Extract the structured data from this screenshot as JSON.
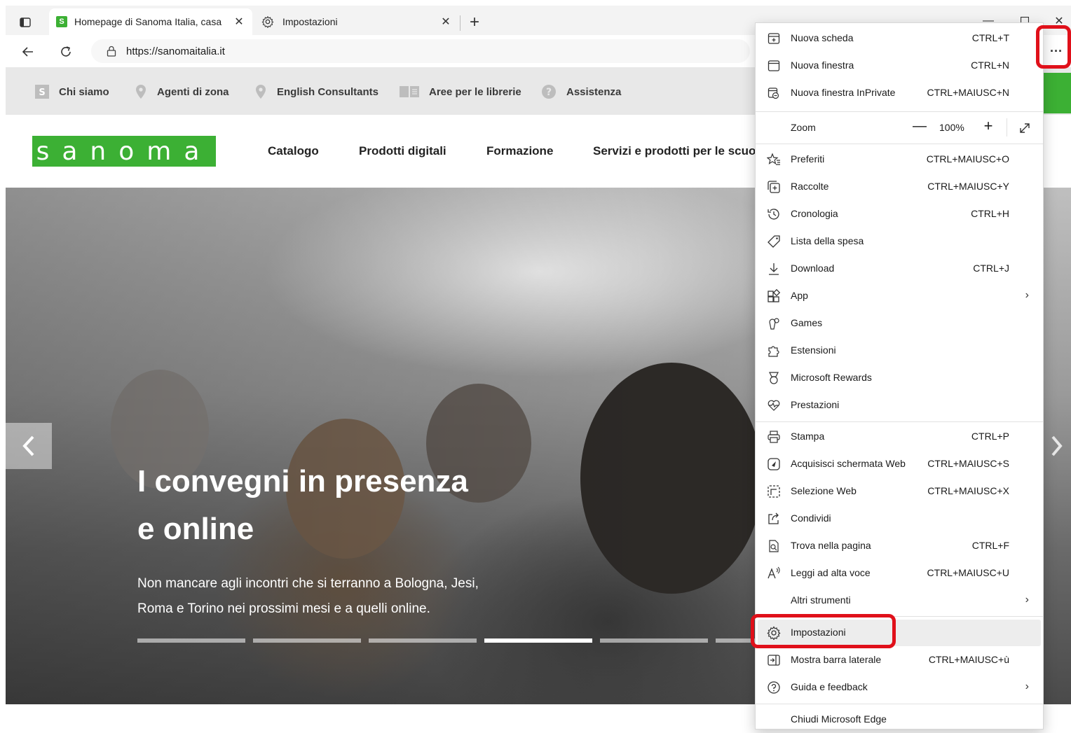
{
  "browser": {
    "tabs": [
      {
        "title": "Homepage di Sanoma Italia, casa",
        "favicon": "S",
        "active": true
      },
      {
        "title": "Impostazioni",
        "active": false
      }
    ],
    "address": {
      "url": "https://sanomaitalia.it"
    }
  },
  "page": {
    "topnav": [
      "Chi siamo",
      "Agenti di zona",
      "English Consultants",
      "Aree per le librerie",
      "Assistenza"
    ],
    "logo_text": "sanoma",
    "mainnav": [
      "Catalogo",
      "Prodotti digitali",
      "Formazione",
      "Servizi e prodotti per le scuo"
    ],
    "hero": {
      "title_line1": "I convegni in presenza",
      "title_line2": "e online",
      "subtitle_line1": "Non mancare agli incontri che si terranno a Bologna, Jesi,",
      "subtitle_line2": "Roma e Torino nei prossimi mesi e a quelli online.",
      "slides": 6,
      "active_slide": 4
    },
    "accent_color": "#3cb034"
  },
  "menu": {
    "group1": [
      {
        "label": "Nuova scheda",
        "shortcut": "CTRL+T",
        "icon": "new-tab-icon"
      },
      {
        "label": "Nuova finestra",
        "shortcut": "CTRL+N",
        "icon": "window-icon"
      },
      {
        "label": "Nuova finestra InPrivate",
        "shortcut": "CTRL+MAIUSC+N",
        "icon": "inprivate-icon"
      }
    ],
    "zoom": {
      "label": "Zoom",
      "value": "100%"
    },
    "group2": [
      {
        "label": "Preferiti",
        "shortcut": "CTRL+MAIUSC+O",
        "icon": "favorites-icon"
      },
      {
        "label": "Raccolte",
        "shortcut": "CTRL+MAIUSC+Y",
        "icon": "collections-icon"
      },
      {
        "label": "Cronologia",
        "shortcut": "CTRL+H",
        "icon": "history-icon"
      },
      {
        "label": "Lista della spesa",
        "shortcut": "",
        "icon": "tag-icon"
      },
      {
        "label": "Download",
        "shortcut": "CTRL+J",
        "icon": "download-icon"
      },
      {
        "label": "App",
        "shortcut": "",
        "icon": "apps-icon",
        "submenu": true
      },
      {
        "label": "Games",
        "shortcut": "",
        "icon": "games-icon"
      },
      {
        "label": "Estensioni",
        "shortcut": "",
        "icon": "extensions-icon"
      },
      {
        "label": "Microsoft Rewards",
        "shortcut": "",
        "icon": "rewards-icon"
      },
      {
        "label": "Prestazioni",
        "shortcut": "",
        "icon": "performance-icon"
      }
    ],
    "group3": [
      {
        "label": "Stampa",
        "shortcut": "CTRL+P",
        "icon": "print-icon"
      },
      {
        "label": "Acquisisci schermata Web",
        "shortcut": "CTRL+MAIUSC+S",
        "icon": "screenshot-icon"
      },
      {
        "label": "Selezione Web",
        "shortcut": "CTRL+MAIUSC+X",
        "icon": "web-select-icon"
      },
      {
        "label": "Condividi",
        "shortcut": "",
        "icon": "share-icon"
      },
      {
        "label": "Trova nella pagina",
        "shortcut": "CTRL+F",
        "icon": "find-icon"
      },
      {
        "label": "Leggi ad alta voce",
        "shortcut": "CTRL+MAIUSC+U",
        "icon": "read-aloud-icon"
      },
      {
        "label": "Altri strumenti",
        "shortcut": "",
        "icon": "",
        "submenu": true
      }
    ],
    "group4": [
      {
        "label": "Impostazioni",
        "shortcut": "",
        "icon": "settings-icon",
        "highlighted": true
      },
      {
        "label": "Mostra barra laterale",
        "shortcut": "CTRL+MAIUSC+ù",
        "icon": "sidebar-icon"
      },
      {
        "label": "Guida e feedback",
        "shortcut": "",
        "icon": "help-icon",
        "submenu": true
      }
    ],
    "close": {
      "label": "Chiudi Microsoft Edge"
    }
  },
  "annotations": {
    "highlight_color": "#e0101a"
  }
}
